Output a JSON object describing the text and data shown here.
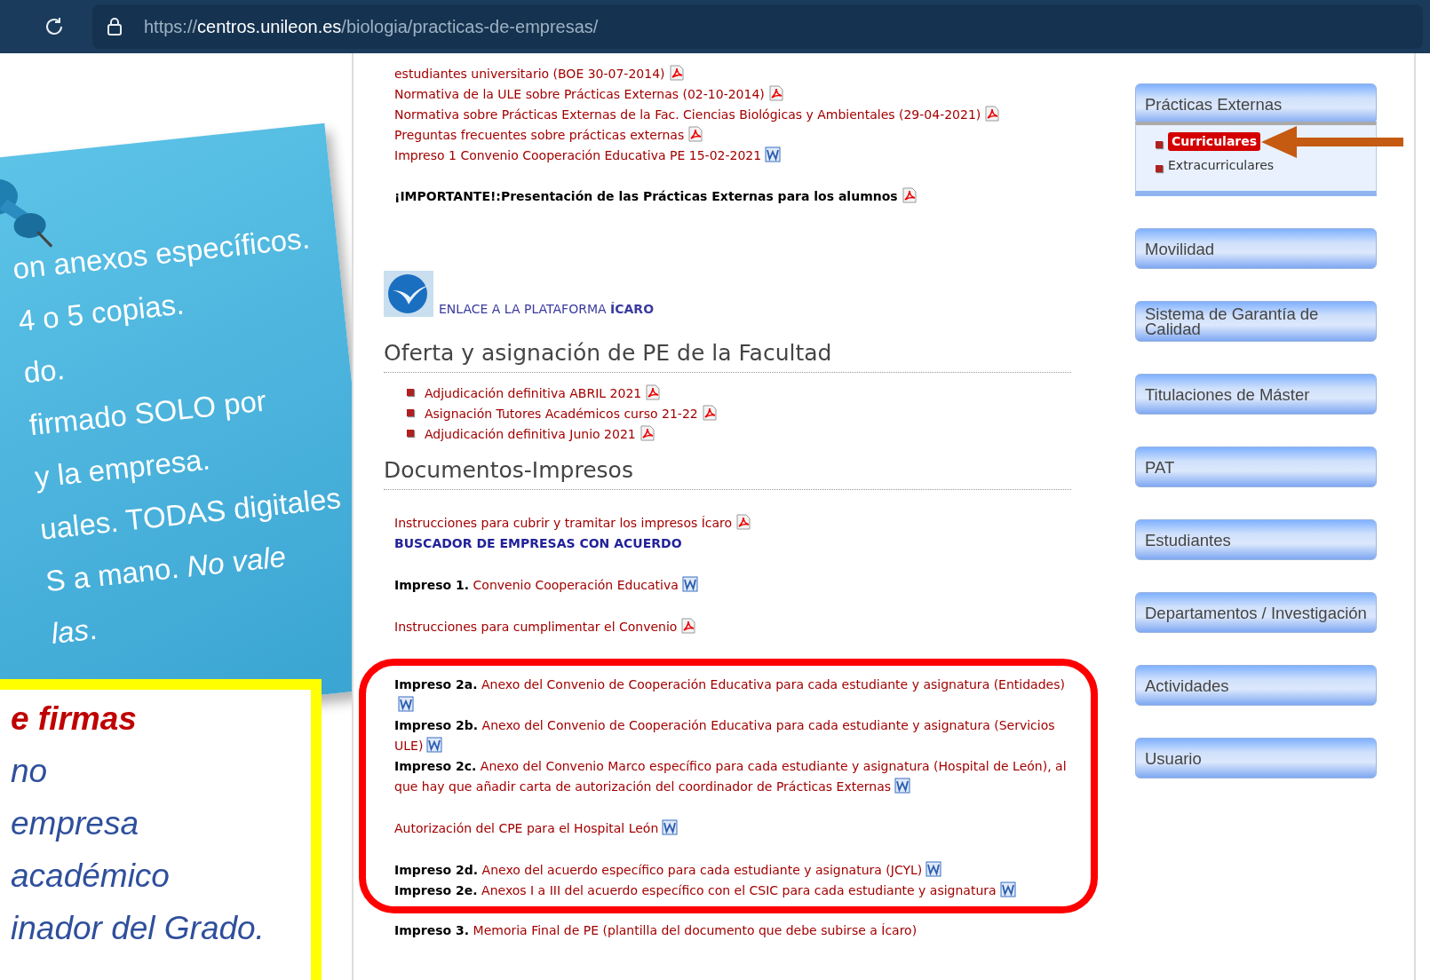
{
  "browser": {
    "url_scheme": "https://",
    "url_host": "centros.unileon.es",
    "url_path": "/biologia/practicas-de-empresas/"
  },
  "sticky_note": {
    "lines": [
      "on anexos específicos.",
      "4 o 5 copias.",
      "do.",
      "firmado SOLO por",
      "y la empresa.",
      "uales. TODAS digitales",
      "S a mano. *No vale*",
      "*las*."
    ]
  },
  "signature_box": {
    "title": "e firmas",
    "lines": [
      "no",
      "empresa",
      "académico",
      "inador del Grado."
    ]
  },
  "top_links": [
    {
      "text": "estudiantes universitario (BOE 30-07-2014)",
      "kind": "pdf"
    },
    {
      "text": "Normativa de la ULE sobre Prácticas Externas (02-10-2014)",
      "kind": "pdf"
    },
    {
      "text": "Normativa sobre Prácticas Externas de la Fac. Ciencias Biológicas y Ambientales (29-04-2021)",
      "kind": "pdf"
    },
    {
      "text": "Preguntas frecuentes sobre prácticas externas",
      "kind": "pdf"
    },
    {
      "text": "Impreso 1 Convenio Cooperación Educativa PE 15-02-2021",
      "kind": "word"
    }
  ],
  "important": {
    "text": "¡IMPORTANTE!:Presentación de las Prácticas Externas para los alumnos",
    "kind": "pdf"
  },
  "icaro_link": {
    "text": "ENLACE A LA PLATAFORMA **ÍCARO**"
  },
  "offer_section": {
    "heading": "Oferta y asignación de PE de la Facultad",
    "items": [
      {
        "text": "Adjudicación definitiva ABRIL 2021",
        "kind": "pdf"
      },
      {
        "text": "Asignación Tutores Académicos curso 21-22",
        "kind": "pdf"
      },
      {
        "text": "Adjudicación definitiva Junio 2021",
        "kind": "pdf"
      }
    ]
  },
  "documents_section": {
    "heading": "Documentos-Impresos",
    "groups": [
      {
        "highlighted": false,
        "paragraphs": [
          [
            {
              "kind": "pdf",
              "text": "Instrucciones para cubrir y tramitar los impresos Ícaro"
            },
            {
              "kind": "caps",
              "text": "BUSCADOR DE EMPRESAS CON ACUERDO"
            }
          ],
          [
            {
              "kind": "word",
              "label": "Impreso 1.",
              "text": "Convenio Cooperación Educativa"
            }
          ],
          [
            {
              "kind": "pdf",
              "text": "Instrucciones para cumplimentar el Convenio"
            }
          ]
        ]
      },
      {
        "highlighted": true,
        "paragraphs": [
          [
            {
              "kind": "word",
              "label": "Impreso 2a.",
              "text": "Anexo del Convenio de Cooperación Educativa para cada estudiante y asignatura (Entidades)"
            },
            {
              "kind": "word",
              "label": "Impreso 2b.",
              "text": "Anexo del Convenio de Cooperación Educativa para cada estudiante y asignatura (Servicios ULE)"
            },
            {
              "kind": "word",
              "label": "Impreso 2c.",
              "text": "Anexo del Convenio Marco específico para cada estudiante y asignatura (Hospital de León), al que hay que añadir carta de autorización del coordinador de Prácticas Externas"
            }
          ],
          [
            {
              "kind": "word",
              "text": "Autorización del CPE para el Hospital León"
            }
          ],
          [
            {
              "kind": "word",
              "label": "Impreso 2d.",
              "text": "Anexo del acuerdo específico para cada estudiante y asignatura (JCYL)"
            },
            {
              "kind": "word",
              "label": "Impreso 2e.",
              "text": "Anexos I a III del acuerdo específico con el CSIC para cada estudiante y asignatura"
            }
          ]
        ]
      },
      {
        "highlighted": false,
        "paragraphs": [
          [
            {
              "kind": "plain",
              "label": "Impreso 3.",
              "text": "Memoria Final de PE (plantilla del documento que debe subirse a Ícaro)"
            }
          ]
        ]
      }
    ]
  },
  "sidebar": {
    "menus": [
      {
        "title": "Prácticas Externas",
        "expanded": true,
        "items": [
          {
            "label": "Curriculares",
            "selected": true
          },
          {
            "label": "Extracurriculares",
            "selected": false
          }
        ]
      },
      {
        "title": "Movilidad",
        "expanded": false
      },
      {
        "title": "Sistema de Garantía de Calidad",
        "expanded": false
      },
      {
        "title": "Titulaciones de Máster",
        "expanded": false
      },
      {
        "title": "PAT",
        "expanded": false
      },
      {
        "title": "Estudiantes",
        "expanded": false
      },
      {
        "title": "Departamentos / Investigación",
        "expanded": false
      },
      {
        "title": "Actividades",
        "expanded": false
      },
      {
        "title": "Usuario",
        "expanded": false
      }
    ]
  }
}
